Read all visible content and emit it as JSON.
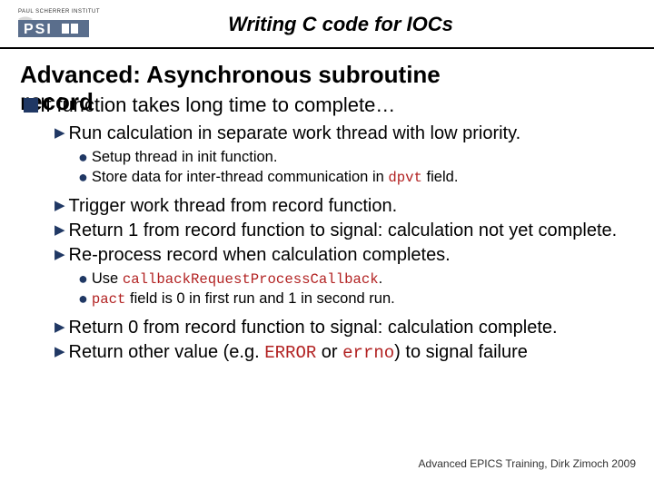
{
  "header": {
    "institute": "PAUL SCHERRER INSTITUT",
    "title": "Writing C code for IOCs"
  },
  "heading_line1": "Advanced: Asynchronous subroutine",
  "heading_line2": "record",
  "l1_text": "If function takes long time to complete…",
  "b1": {
    "text": "Run calculation in separate work thread with low priority.",
    "sub1": "Setup thread in init function.",
    "sub2_a": "Store data for inter-thread communication in ",
    "sub2_mono": "dpvt",
    "sub2_b": " field."
  },
  "b2": "Trigger work thread from record function.",
  "b3": "Return 1 from record function to signal: calculation not yet complete.",
  "b4": {
    "text": "Re-process record when calculation completes.",
    "sub1_a": "Use ",
    "sub1_mono": "callbackRequestProcessCallback",
    "sub1_b": ".",
    "sub2_mono": "pact",
    "sub2_b": " field is 0 in first run and 1 in second run."
  },
  "b5": "Return 0 from record function to signal: calculation complete.",
  "b6_a": "Return other value (e.g. ",
  "b6_mono1": "ERROR",
  "b6_mid": " or ",
  "b6_mono2": "errno",
  "b6_b": ") to signal failure",
  "footer": "Advanced EPICS Training, Dirk Zimoch 2009"
}
